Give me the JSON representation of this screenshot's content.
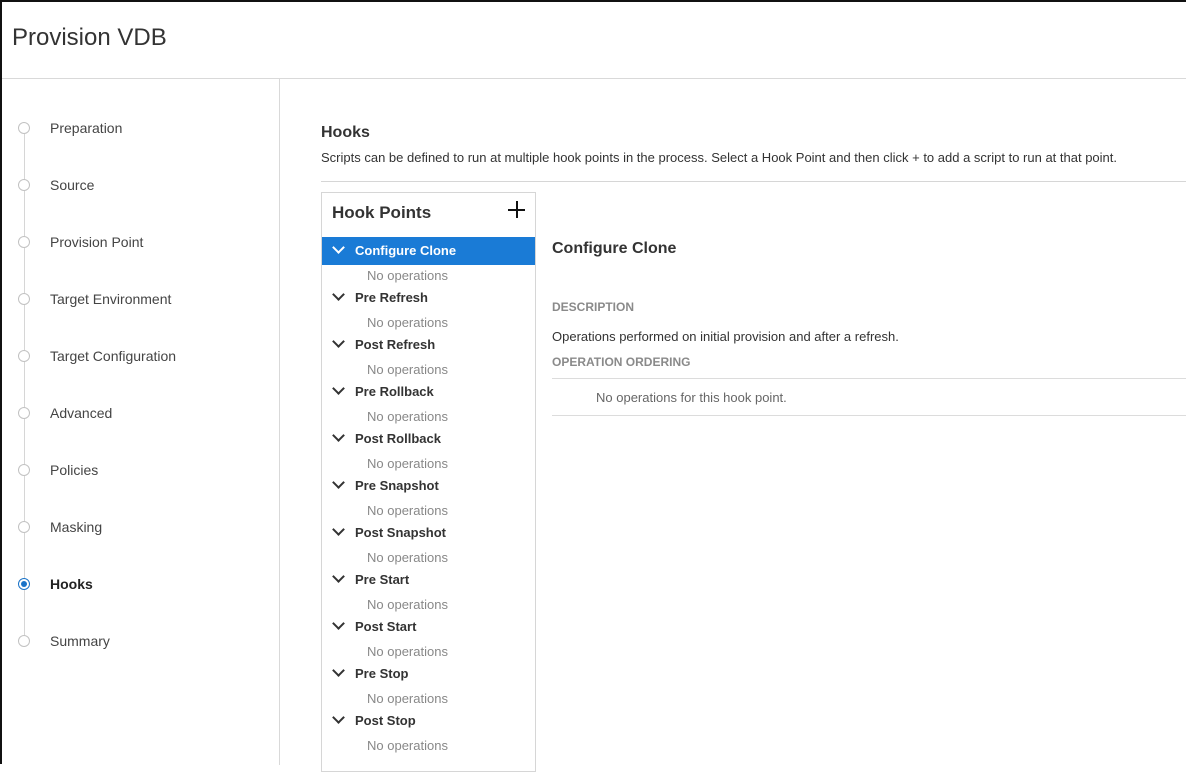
{
  "window": {
    "title": "Provision VDB"
  },
  "steps": [
    {
      "label": "Preparation",
      "active": false
    },
    {
      "label": "Source",
      "active": false
    },
    {
      "label": "Provision Point",
      "active": false
    },
    {
      "label": "Target Environment",
      "active": false
    },
    {
      "label": "Target Configuration",
      "active": false
    },
    {
      "label": "Advanced",
      "active": false
    },
    {
      "label": "Policies",
      "active": false
    },
    {
      "label": "Masking",
      "active": false
    },
    {
      "label": "Hooks",
      "active": true
    },
    {
      "label": "Summary",
      "active": false
    }
  ],
  "hooks": {
    "title": "Hooks",
    "description": "Scripts can be defined to run at multiple hook points in the process. Select a Hook Point and then click + to add a script to run at that point.",
    "panel_title": "Hook Points",
    "add_icon": "plus-icon",
    "points": [
      {
        "name": "Configure Clone",
        "ops": "No operations",
        "selected": true
      },
      {
        "name": "Pre Refresh",
        "ops": "No operations",
        "selected": false
      },
      {
        "name": "Post Refresh",
        "ops": "No operations",
        "selected": false
      },
      {
        "name": "Pre Rollback",
        "ops": "No operations",
        "selected": false
      },
      {
        "name": "Post Rollback",
        "ops": "No operations",
        "selected": false
      },
      {
        "name": "Pre Snapshot",
        "ops": "No operations",
        "selected": false
      },
      {
        "name": "Post Snapshot",
        "ops": "No operations",
        "selected": false
      },
      {
        "name": "Pre Start",
        "ops": "No operations",
        "selected": false
      },
      {
        "name": "Post Start",
        "ops": "No operations",
        "selected": false
      },
      {
        "name": "Pre Stop",
        "ops": "No operations",
        "selected": false
      },
      {
        "name": "Post Stop",
        "ops": "No operations",
        "selected": false
      }
    ]
  },
  "detail": {
    "title": "Configure Clone",
    "description_heading": "DESCRIPTION",
    "description": "Operations performed on initial provision and after a refresh.",
    "ordering_heading": "OPERATION ORDERING",
    "empty_message": "No operations for this hook point."
  },
  "colors": {
    "accent": "#1a7bd6",
    "border": "#d6d6d6",
    "muted": "#888888"
  }
}
